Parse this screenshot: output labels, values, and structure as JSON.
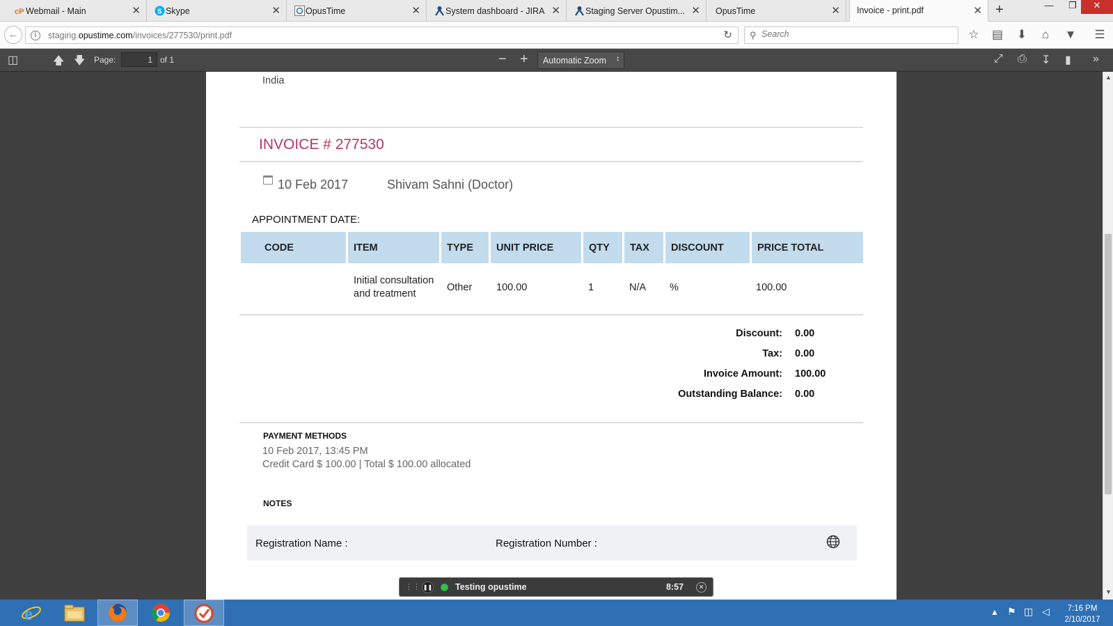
{
  "browser": {
    "tabs": [
      {
        "title": "Webmail - Main",
        "icon": "cpanel-icon"
      },
      {
        "title": "Skype",
        "icon": "skype-icon"
      },
      {
        "title": "OpusTime",
        "icon": "opustime-icon"
      },
      {
        "title": "System dashboard - JIRA",
        "icon": "jira-icon"
      },
      {
        "title": "Staging Server Opustim...",
        "icon": "jira-icon"
      },
      {
        "title": "OpusTime",
        "icon": "blank-icon"
      },
      {
        "title": "Invoice - print.pdf",
        "icon": "none",
        "active": true
      }
    ],
    "url_prefix": "staging.",
    "url_domain": "opustime.com",
    "url_path": "/invoices/277530/print.pdf",
    "search_placeholder": "Search"
  },
  "pdf_toolbar": {
    "page_label": "Page:",
    "page_value": "1",
    "page_of": "of 1",
    "zoom": "Automatic Zoom"
  },
  "invoice": {
    "country": "India",
    "title": "INVOICE # 277530",
    "date": "10 Feb 2017",
    "practitioner": "Shivam Sahni (Doctor)",
    "appointment_date_label": "APPOINTMENT DATE:",
    "columns": [
      "CODE",
      "ITEM",
      "TYPE",
      "UNIT PRICE",
      "QTY",
      "TAX",
      "DISCOUNT",
      "PRICE TOTAL"
    ],
    "row": {
      "code": "",
      "item_line1": "Initial consultation",
      "item_line2": "and treatment",
      "type": "Other",
      "unit_price": "100.00",
      "qty": "1",
      "tax": "N/A",
      "discount": "%",
      "price_total": "100.00"
    },
    "totals": [
      {
        "label": "Discount:",
        "value": "0.00"
      },
      {
        "label": "Tax:",
        "value": "0.00"
      },
      {
        "label": "Invoice Amount:",
        "value": "100.00"
      },
      {
        "label": "Outstanding Balance:",
        "value": "0.00"
      }
    ],
    "payment_methods_title": "PAYMENT METHODS",
    "payment_datetime": "10 Feb 2017, 13:45 PM",
    "payment_summary": "Credit Card $ 100.00 | Total $ 100.00 allocated",
    "notes_title": "NOTES",
    "registration_name_label": "Registration Name :",
    "registration_number_label": "Registration Number :"
  },
  "recorder": {
    "title": "Testing opustime",
    "time": "8:57"
  },
  "taskbar": {
    "time": "7:16 PM",
    "date": "2/10/2017"
  }
}
